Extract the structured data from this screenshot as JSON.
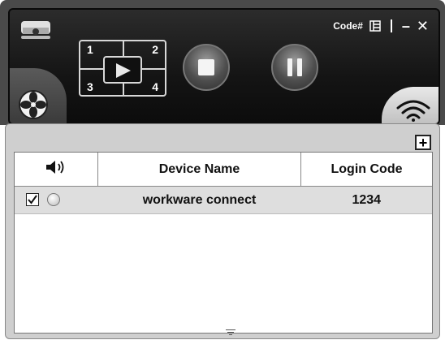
{
  "toolbar": {
    "code_label": "Code#",
    "minimize_label": "–",
    "close_label": "✕",
    "quad_numbers": [
      "1",
      "2",
      "3",
      "4"
    ]
  },
  "icons": {
    "logo": "projector-icon",
    "fan": "fan-icon",
    "wifi": "wifi-icon",
    "play": "play-icon",
    "stop": "stop-icon",
    "pause": "pause-icon",
    "list": "list-icon",
    "add": "plus-icon",
    "speaker": "speaker-icon"
  },
  "device_list": {
    "add_label": "+",
    "columns": [
      "",
      "Device Name",
      "Login Code"
    ],
    "rows": [
      {
        "checked": true,
        "device_name": "workware connect",
        "login_code": "1234"
      }
    ]
  },
  "colors": {
    "panel_bg": "#141414",
    "accent_light": "#d8d8d8",
    "row_bg": "#dedede"
  }
}
